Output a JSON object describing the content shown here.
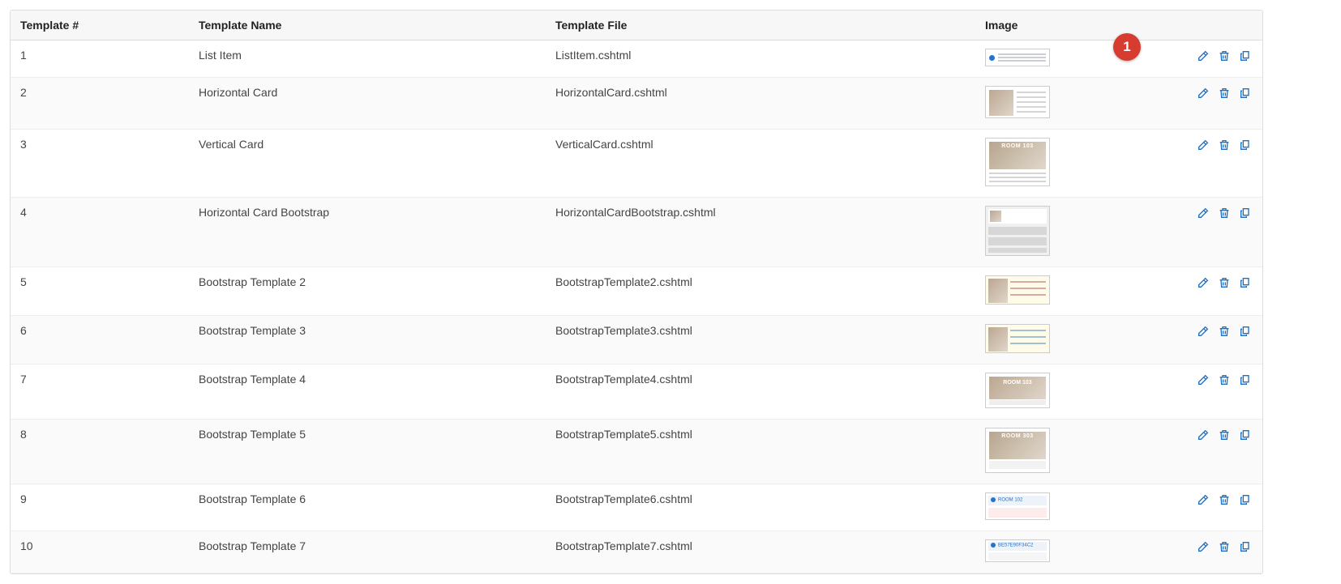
{
  "callout": "1",
  "columns": {
    "num": "Template #",
    "name": "Template Name",
    "file": "Template File",
    "image": "Image"
  },
  "thumb_labels": {
    "room103": "ROOM 103",
    "room303": "ROOM 303",
    "room102": "ROOM 102",
    "code": "BE57E90F34C2"
  },
  "rows": [
    {
      "num": "1",
      "name": "List Item",
      "file": "ListItem.cshtml"
    },
    {
      "num": "2",
      "name": "Horizontal Card",
      "file": "HorizontalCard.cshtml"
    },
    {
      "num": "3",
      "name": "Vertical Card",
      "file": "VerticalCard.cshtml"
    },
    {
      "num": "4",
      "name": "Horizontal Card Bootstrap",
      "file": "HorizontalCardBootstrap.cshtml"
    },
    {
      "num": "5",
      "name": "Bootstrap Template 2",
      "file": "BootstrapTemplate2.cshtml"
    },
    {
      "num": "6",
      "name": "Bootstrap Template 3",
      "file": "BootstrapTemplate3.cshtml"
    },
    {
      "num": "7",
      "name": "Bootstrap Template 4",
      "file": "BootstrapTemplate4.cshtml"
    },
    {
      "num": "8",
      "name": "Bootstrap Template 5",
      "file": "BootstrapTemplate5.cshtml"
    },
    {
      "num": "9",
      "name": "Bootstrap Template 6",
      "file": "BootstrapTemplate6.cshtml"
    },
    {
      "num": "10",
      "name": "Bootstrap Template 7",
      "file": "BootstrapTemplate7.cshtml"
    }
  ]
}
